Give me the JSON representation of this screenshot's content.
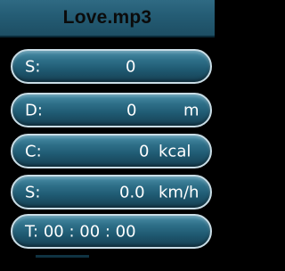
{
  "title": "Love.mp3",
  "stats": {
    "speed": {
      "label": "S:",
      "value": "0",
      "unit": ""
    },
    "distance": {
      "label": "D:",
      "value": "0",
      "unit": "m"
    },
    "calories": {
      "label": "C:",
      "value": "0",
      "unit": "kcal"
    },
    "speed_kmh": {
      "label": "S:",
      "value": "0.0",
      "unit": "km/h"
    },
    "time": {
      "label": "T:",
      "value": "00 : 00 : 00"
    }
  },
  "colors": {
    "title_bar": "#245c74",
    "row_fill": "#2e6f88",
    "row_border": "#c9dde6",
    "background": "#000000"
  }
}
